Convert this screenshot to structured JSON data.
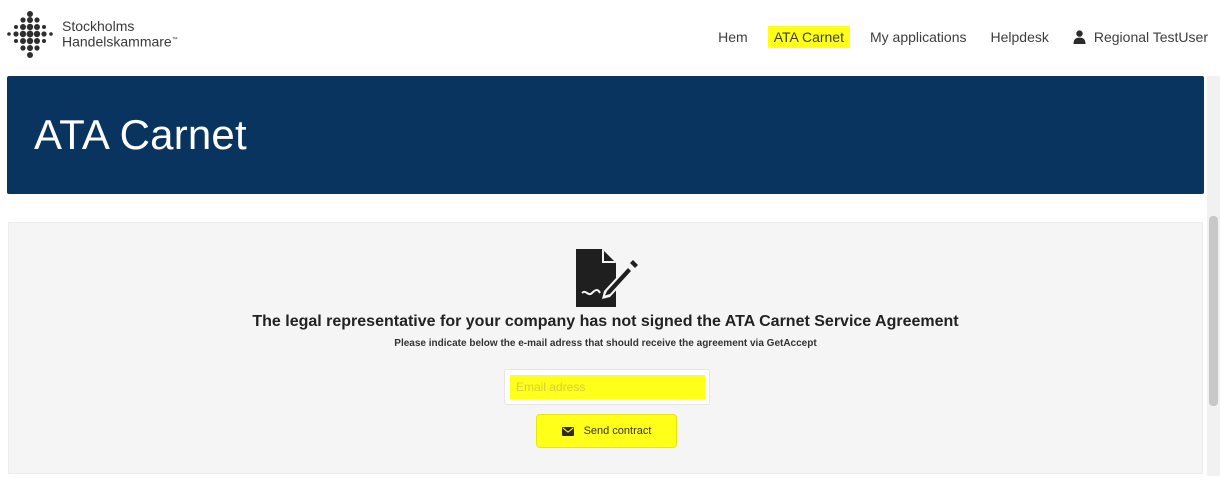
{
  "header": {
    "brand_line1": "Stockholms",
    "brand_line2": "Handelskammare",
    "brand_tm": "™"
  },
  "nav": {
    "items": [
      {
        "label": "Hem",
        "highlighted": false
      },
      {
        "label": "ATA Carnet",
        "highlighted": true
      },
      {
        "label": "My applications",
        "highlighted": false
      },
      {
        "label": "Helpdesk",
        "highlighted": false
      }
    ],
    "user_label": "Regional TestUser",
    "user_icon": "user-icon"
  },
  "hero": {
    "title": "ATA Carnet"
  },
  "agreement": {
    "icon": "signed-document-icon",
    "headline": "The legal representative for your company has not signed the ATA Carnet Service Agreement",
    "subline": "Please indicate below the e-mail adress that should receive the agreement via GetAccept",
    "email_placeholder": "Email adress",
    "email_value": "",
    "send_label": "Send contract",
    "send_icon": "envelope-icon"
  },
  "colors": {
    "hero_background": "#0a3460",
    "highlight": "#ffff1a",
    "panel_background": "#f5f5f5"
  }
}
